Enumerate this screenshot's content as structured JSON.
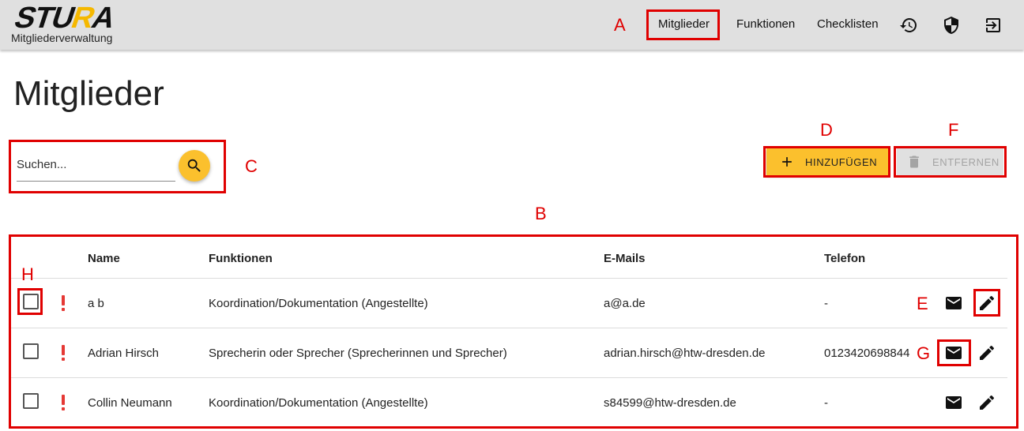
{
  "header": {
    "logo_text": "STURA",
    "app_subtitle": "Mitgliederverwaltung",
    "nav": [
      {
        "label": "Mitglieder"
      },
      {
        "label": "Funktionen"
      },
      {
        "label": "Checklisten"
      }
    ],
    "nav_icons": [
      "history-icon",
      "shield-icon",
      "logout-icon"
    ]
  },
  "page": {
    "title": "Mitglieder"
  },
  "search": {
    "placeholder": "Suchen...",
    "value": ""
  },
  "actions": {
    "add_label": "HINZUFÜGEN",
    "remove_label": "ENTFERNEN"
  },
  "table": {
    "columns": [
      "Name",
      "Funktionen",
      "E-Mails",
      "Telefon"
    ],
    "rows": [
      {
        "name": "a b",
        "functions": "Koordination/Dokumentation (Angestellte)",
        "email": "a@a.de",
        "phone": "-"
      },
      {
        "name": "Adrian Hirsch",
        "functions": "Sprecherin oder Sprecher (Sprecherinnen und Sprecher)",
        "email": "adrian.hirsch@htw-dresden.de",
        "phone": "0123420698844"
      },
      {
        "name": "Collin Neumann",
        "functions": "Koordination/Dokumentation (Angestellte)",
        "email": "s84599@htw-dresden.de",
        "phone": "-"
      }
    ]
  },
  "annotations": {
    "A": "A",
    "B": "B",
    "C": "C",
    "D": "D",
    "E": "E",
    "F": "F",
    "G": "G",
    "H": "H"
  },
  "colors": {
    "accent": "#fbc02d",
    "annotation": "#e00000",
    "warning": "#e53935",
    "topbar": "#e0e0e0"
  }
}
